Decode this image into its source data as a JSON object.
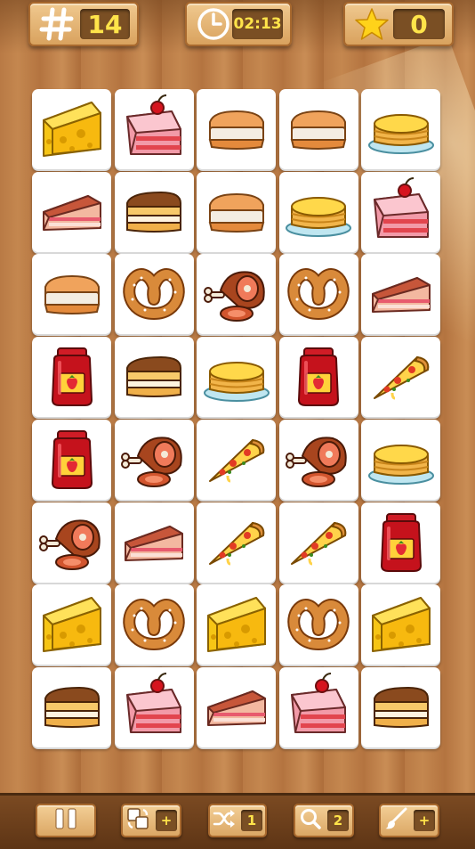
{
  "hud": {
    "moves_value": "14",
    "time_value": "02:13",
    "score_value": "0"
  },
  "board": {
    "rows": 8,
    "cols": 5,
    "tiles": [
      [
        "cheese",
        "cake",
        "sandwich",
        "sandwich",
        "pancakes"
      ],
      [
        "pie",
        "sponge",
        "sandwich",
        "pancakes",
        "cake"
      ],
      [
        "sandwich",
        "pretzel",
        "ham",
        "pretzel",
        "pie"
      ],
      [
        "jam",
        "sponge",
        "pancakes",
        "jam",
        "pizza"
      ],
      [
        "jam",
        "ham",
        "pizza",
        "ham",
        "pancakes"
      ],
      [
        "ham",
        "pie",
        "pizza",
        "pizza",
        "jam"
      ],
      [
        "cheese",
        "pretzel",
        "cheese",
        "pretzel",
        "cheese"
      ],
      [
        "sponge",
        "cake",
        "pie",
        "cake",
        "sponge"
      ]
    ]
  },
  "toolbar": {
    "pause_icon": "pause-icon",
    "swap_icon": "swap-icon",
    "swap_badge": "+",
    "shuffle_icon": "shuffle-icon",
    "shuffle_badge": "1",
    "search_icon": "magnifier-icon",
    "search_badge": "2",
    "brush_icon": "brush-icon",
    "brush_badge": "+"
  },
  "colors": {
    "badge_bg": "#7a4f24",
    "badge_text": "#ffe44a",
    "wood": "#b97a45"
  }
}
